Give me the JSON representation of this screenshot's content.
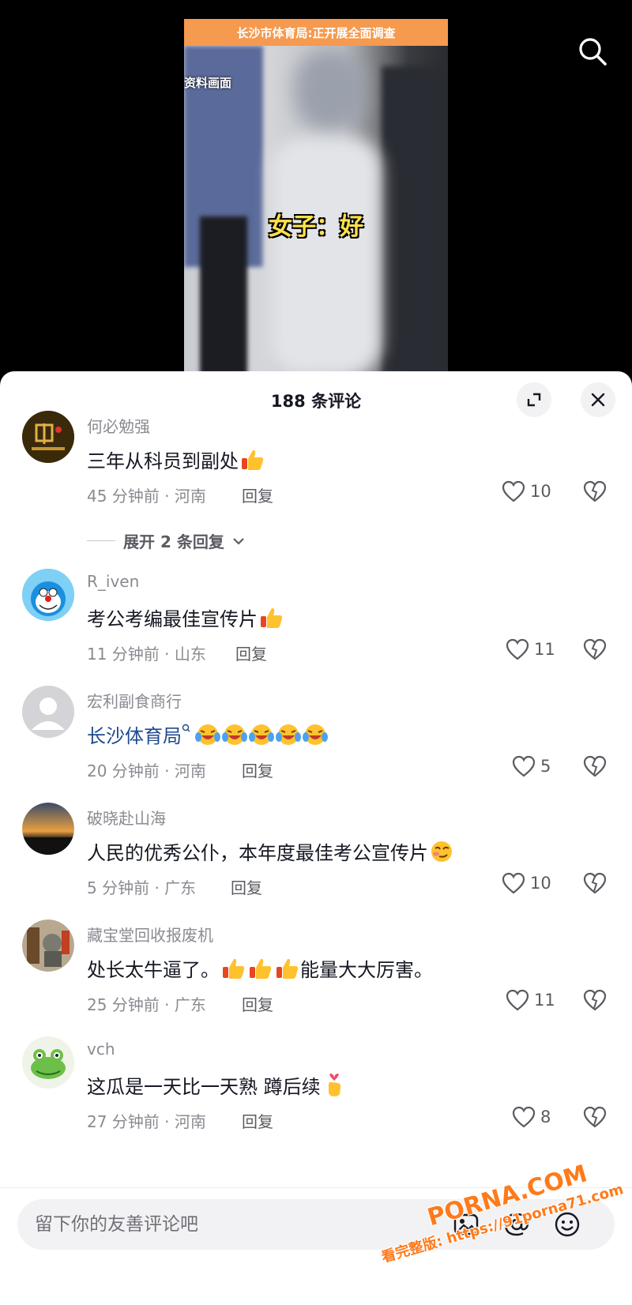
{
  "video": {
    "banner": "长沙市体育局:正开展全面调查",
    "caption_left": "资料画面",
    "subtitle": "女子：好"
  },
  "sheet": {
    "title": "188 条评论"
  },
  "comments": [
    {
      "user": "何必勉强",
      "text": "三年从科员到副处",
      "time_location": "45 分钟前 · 河南",
      "reply": "回复",
      "likes": "10",
      "expand_replies": "展开 2 条回复",
      "emojis": [
        "thumbs-up"
      ]
    },
    {
      "user": "R_iven",
      "text": "考公考编最佳宣传片",
      "time_location": "11 分钟前 · 山东",
      "reply": "回复",
      "likes": "11",
      "emojis": [
        "thumbs-up"
      ]
    },
    {
      "user": "宏利副食商行",
      "text": "长沙体育局",
      "time_location": "20 分钟前 · 河南",
      "reply": "回复",
      "likes": "5",
      "emojis": [
        "laughing-crying",
        "laughing-crying",
        "laughing-crying",
        "laughing-crying",
        "laughing-crying"
      ]
    },
    {
      "user": "破晓赴山海",
      "text": "人民的优秀公仆，本年度最佳考公宣传片",
      "time_location": "5 分钟前 · 广东",
      "reply": "回复",
      "likes": "10",
      "emojis": [
        "smirk"
      ]
    },
    {
      "user": "藏宝堂回收报废机",
      "text_before": "处长太牛逼了。",
      "text_after": "能量大大厉害。",
      "time_location": "25 分钟前 · 广东",
      "reply": "回复",
      "likes": "11",
      "emojis": [
        "thumbs-up",
        "thumbs-up",
        "thumbs-up"
      ]
    },
    {
      "user": "vch",
      "text": "这瓜是一天比一天熟 蹲后续",
      "time_location": "27 分钟前 · 河南",
      "reply": "回复",
      "likes": "8",
      "emojis": [
        "finger-heart"
      ]
    }
  ],
  "input": {
    "placeholder": "留下你的友善评论吧"
  },
  "watermark": {
    "brand": "PORNA.COM",
    "text": "看完整版: https://91porna71.com"
  },
  "colors": {
    "banner": "#f59a4f",
    "subtitle": "#ffe04a",
    "link": "#1f4a8f",
    "watermark": "#ff7a1a"
  },
  "icons": [
    "search-icon",
    "expand-icon",
    "close-icon",
    "heart-icon",
    "dislike-heart-icon",
    "image-icon",
    "at-icon",
    "emoji-icon"
  ]
}
